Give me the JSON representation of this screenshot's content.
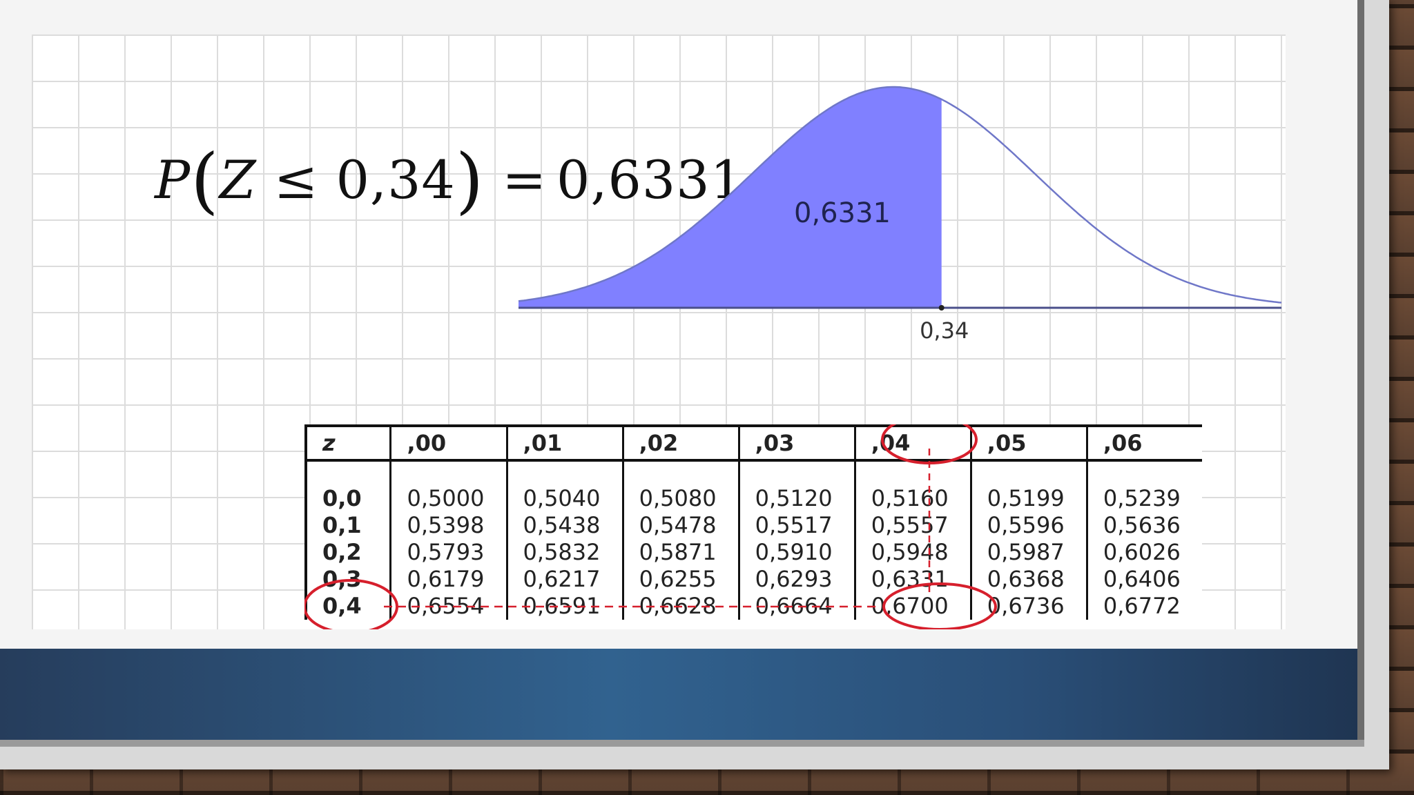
{
  "formula": {
    "P": "P",
    "open": "(",
    "var": "Z",
    "op": "≤",
    "z": "0,34",
    "close": ")",
    "eq": "=",
    "result": "0,6331"
  },
  "curve": {
    "area_label": "0,6331",
    "z_label": "0,34",
    "z_value": 0.34,
    "fill_color": "#8080ff",
    "line_color": "#6f77c8"
  },
  "table": {
    "headers": [
      "z",
      ",00",
      ",01",
      ",02",
      ",03",
      ",04",
      ",05",
      ",06"
    ],
    "rows": [
      [
        "0,0",
        "0,5000",
        "0,5040",
        "0,5080",
        "0,5120",
        "0,5160",
        "0,5199",
        "0,5239"
      ],
      [
        "0,1",
        "0,5398",
        "0,5438",
        "0,5478",
        "0,5517",
        "0,5557",
        "0,5596",
        "0,5636"
      ],
      [
        "0,2",
        "0,5793",
        "0,5832",
        "0,5871",
        "0,5910",
        "0,5948",
        "0,5987",
        "0,6026"
      ],
      [
        "0,3",
        "0,6179",
        "0,6217",
        "0,6255",
        "0,6293",
        "0,6331",
        "0,6368",
        "0,6406"
      ],
      [
        "0,4",
        "0,6554",
        "0,6591",
        "0,6628",
        "0,6664",
        "0,6700",
        "0,6736",
        "0,6772"
      ]
    ],
    "highlight_color": "#d61f2c",
    "highlight_row": "0,3",
    "highlight_col": ",04"
  },
  "colors": {
    "bar_start": "#263d5c",
    "bar_mid": "#31628f",
    "bar_end": "#1f3552"
  }
}
